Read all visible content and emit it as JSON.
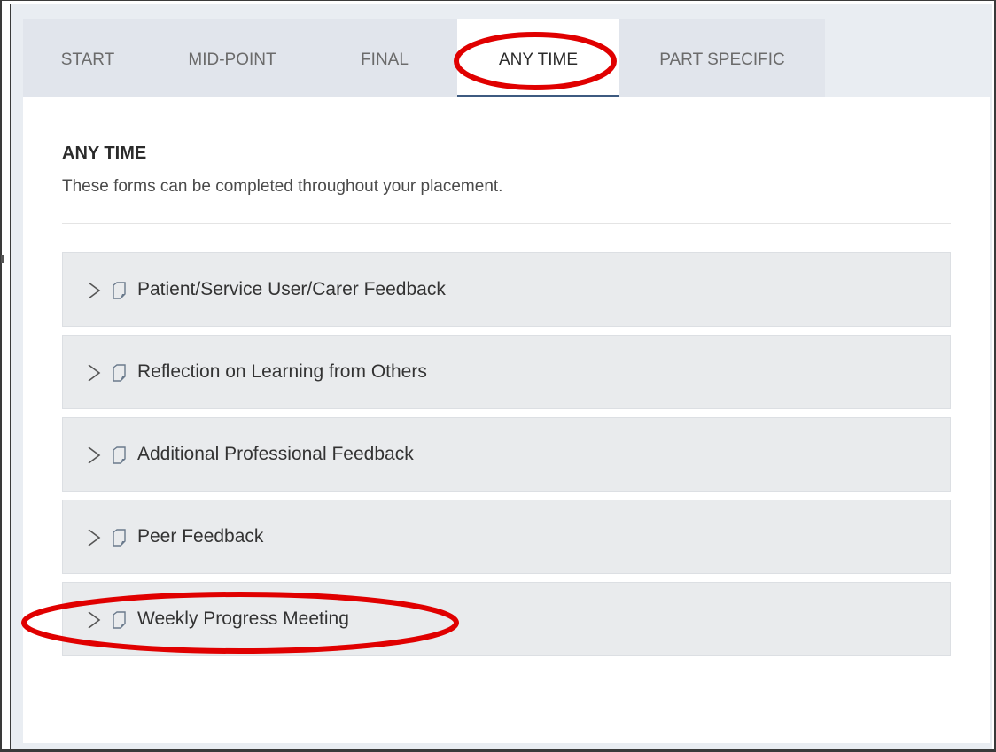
{
  "tabs": [
    {
      "label": "START",
      "active": false
    },
    {
      "label": "MID-POINT",
      "active": false
    },
    {
      "label": "FINAL",
      "active": false
    },
    {
      "label": "ANY TIME",
      "active": true
    },
    {
      "label": "PART SPECIFIC",
      "active": false
    }
  ],
  "section": {
    "title": "ANY TIME",
    "description": "These forms can be completed throughout your placement."
  },
  "forms": [
    {
      "label": "Patient/Service User/Carer Feedback",
      "icon": "document-icon"
    },
    {
      "label": "Reflection on Learning from Others",
      "icon": "document-icon"
    },
    {
      "label": "Additional Professional Feedback",
      "icon": "document-icon"
    },
    {
      "label": "Peer Feedback",
      "icon": "document-icon"
    },
    {
      "label": "Weekly Progress Meeting",
      "icon": "document-icon"
    }
  ],
  "annotations": {
    "highlight_color": "#e00000",
    "highlighted": [
      "ANY TIME",
      "Weekly Progress Meeting"
    ]
  },
  "colors": {
    "active_tab_underline": "#3d5a80",
    "tab_bar": "#e1e5ec",
    "accordion_bg": "#e9ebed"
  }
}
